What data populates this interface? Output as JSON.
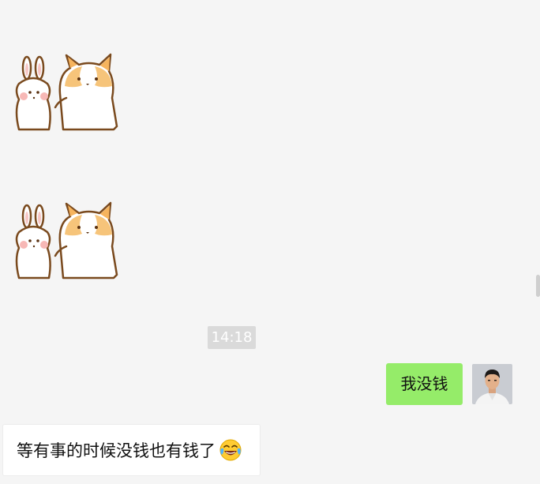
{
  "chat": {
    "messages": [
      {
        "type": "sticker",
        "side": "left",
        "sticker_icon": "bunny-and-corgi-sticker"
      },
      {
        "type": "sticker",
        "side": "left",
        "sticker_icon": "bunny-and-corgi-sticker"
      },
      {
        "type": "timestamp",
        "text": "14:18"
      },
      {
        "type": "text",
        "side": "right",
        "text": "我没钱",
        "bubble_color": "#95ec69"
      },
      {
        "type": "text",
        "side": "left",
        "text": "等有事的时候没钱也有钱了",
        "emoji_icon": "tears-of-joy-emoji",
        "bubble_color": "#ffffff"
      }
    ]
  },
  "colors": {
    "background": "#f5f5f5",
    "outgoing_bubble": "#95ec69",
    "incoming_bubble": "#ffffff",
    "timestamp_bg": "#dadada"
  }
}
